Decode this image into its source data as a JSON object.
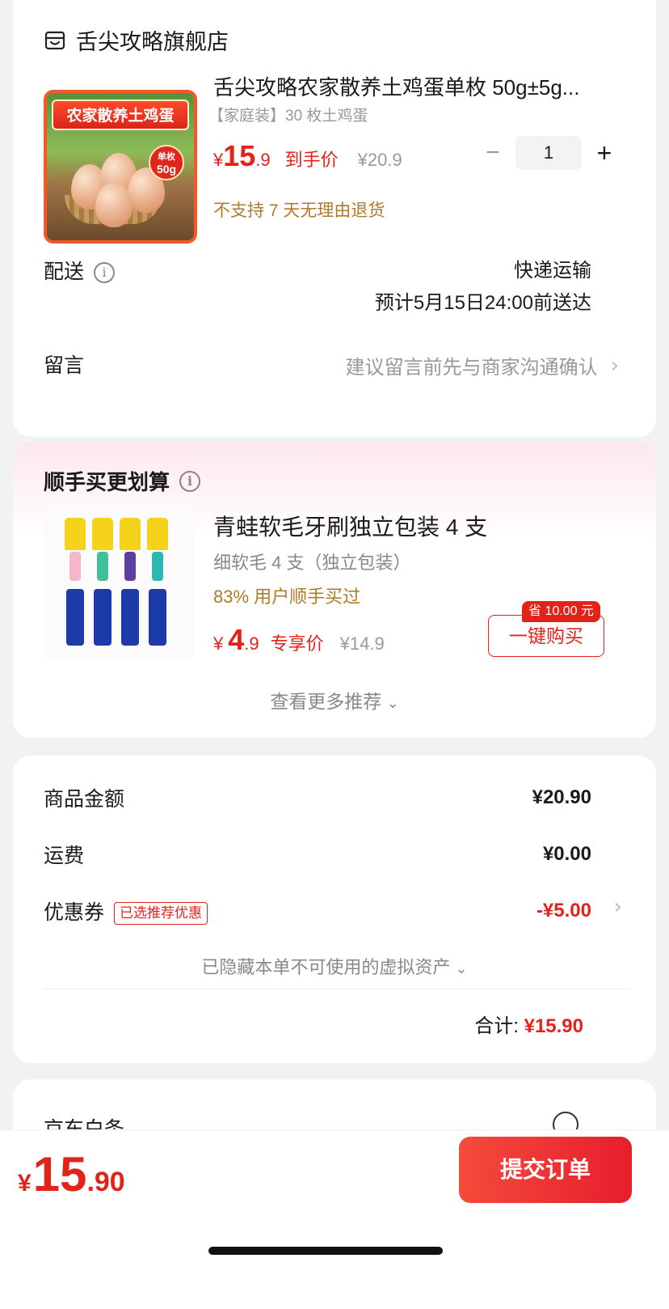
{
  "store": {
    "name": "舌尖攻略旗舰店",
    "icon": "store-icon"
  },
  "product": {
    "image_banner": "农家散养土鸡蛋",
    "image_badge_top": "单枚",
    "image_badge_weight": "50g",
    "title": "舌尖攻略农家散养土鸡蛋单枚 50g±5g...",
    "spec": "【家庭装】30 枚土鸡蛋",
    "currency": "¥",
    "price_int": "15",
    "price_dec": ".9",
    "price_label": "到手价",
    "original_price": "¥20.9",
    "quantity": "1",
    "minus": "−",
    "plus": "+",
    "return_note": "不支持 7 天无理由退货"
  },
  "delivery": {
    "label": "配送",
    "method": "快递运输",
    "eta": "预计5月15日24:00前送达"
  },
  "message": {
    "label": "留言",
    "hint": "建议留言前先与商家沟通确认"
  },
  "recommend": {
    "title": "顺手买更划算",
    "item": {
      "name": "青蛙软毛牙刷独立包装 4 支",
      "spec": "细软毛 4 支（独立包装）",
      "bought": "83% 用户顺手买过",
      "currency": "¥",
      "price_int": "4",
      "price_dec": ".9",
      "price_label": "专享价",
      "original_price": "¥14.9",
      "save_tag": "省 10.00 元",
      "button": "一键购买"
    },
    "more": "查看更多推荐"
  },
  "summary": {
    "goods_label": "商品金额",
    "goods_value": "¥20.90",
    "shipping_label": "运费",
    "shipping_value": "¥0.00",
    "coupon_label": "优惠券",
    "coupon_tag": "已选推荐优惠",
    "coupon_value": "-¥5.00",
    "hidden_assets": "已隐藏本单不可使用的虚拟资产",
    "total_label": "合计:",
    "total_value": "¥15.90"
  },
  "baitiao": {
    "label": "京东白条"
  },
  "bottom": {
    "currency": "¥",
    "total_int": "15",
    "total_dec": ".90",
    "submit": "提交订单"
  },
  "colors": {
    "accent": "#e2231a",
    "note": "#b07a2a",
    "muted": "#999999"
  }
}
